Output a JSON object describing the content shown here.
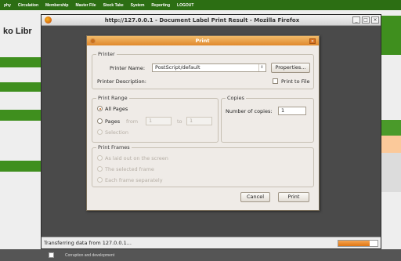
{
  "background": {
    "nav": [
      "phy",
      "Circulation",
      "Membership",
      "Master File",
      "Stock Take",
      "System",
      "Reporting",
      "LOGOUT"
    ],
    "title_fragment": "ko Libr",
    "bottom_text": "Corruption and development"
  },
  "window": {
    "title": "http://127.0.0.1 - Document Label Print Result - Mozilla Firefox",
    "btn_min": "_",
    "btn_max": "□",
    "btn_close": "×",
    "status": "Transferring data from 127.0.0.1...",
    "progress_fraction": 0.8
  },
  "dialog": {
    "title": "Print",
    "close": "×",
    "printer": {
      "legend": "Printer",
      "name_label": "Printer Name:",
      "name_value": "PostScript/default",
      "properties": "Properties...",
      "desc_label": "Printer Description:",
      "print_to_file": "Print to File"
    },
    "range": {
      "legend": "Print Range",
      "all_pages": "All Pages",
      "pages": "Pages",
      "from": "from",
      "from_value": "1",
      "to": "to",
      "to_value": "1",
      "selection": "Selection"
    },
    "copies": {
      "legend": "Copies",
      "label": "Number of copies:",
      "value": "1"
    },
    "frames": {
      "legend": "Print Frames",
      "as_laid_out": "As laid out on the screen",
      "selected_frame": "The selected frame",
      "each_frame": "Each frame separately"
    },
    "cancel": "Cancel",
    "print": "Print"
  },
  "colors": {
    "nav_green": "#2c6e13",
    "dialog_title": "#e0892d",
    "progress": "#e07613"
  }
}
